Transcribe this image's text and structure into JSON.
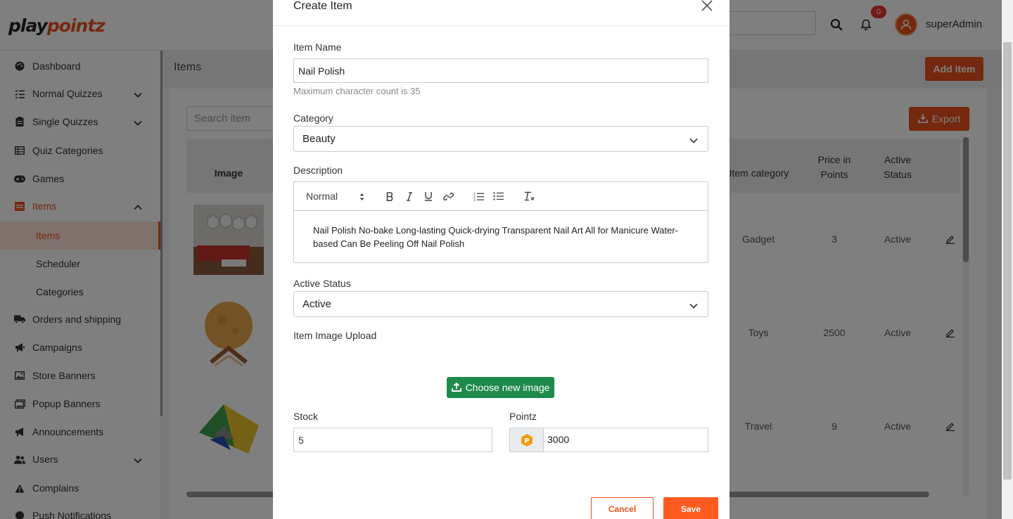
{
  "brand": {
    "part1": "play",
    "part2": "pointz"
  },
  "header": {
    "notification_count": "0",
    "username": "superAdmin"
  },
  "sidebar": {
    "items": [
      {
        "label": "Dashboard",
        "icon": "palette-icon"
      },
      {
        "label": "Normal Quizzes",
        "icon": "list-check-icon"
      },
      {
        "label": "Single Quizzes",
        "icon": "clipboard-icon"
      },
      {
        "label": "Quiz Categories",
        "icon": "table-list-icon"
      },
      {
        "label": "Games",
        "icon": "gamepad-icon"
      },
      {
        "label": "Items",
        "icon": "item-box-icon"
      },
      {
        "label": "Orders and shipping",
        "icon": "truck-icon"
      },
      {
        "label": "Campaigns",
        "icon": "megaphone-icon"
      },
      {
        "label": "Store Banners",
        "icon": "image-icon"
      },
      {
        "label": "Popup Banners",
        "icon": "images-icon"
      },
      {
        "label": "Announcements",
        "icon": "bullhorn-icon"
      },
      {
        "label": "Users",
        "icon": "users-icon"
      },
      {
        "label": "Complains",
        "icon": "warning-icon"
      },
      {
        "label": "Push Notifications",
        "icon": "circle-icon"
      }
    ],
    "sub_items": [
      "Items",
      "Scheduler",
      "Categories"
    ]
  },
  "main": {
    "title": "Items",
    "add_button": "Add item",
    "search_placeholder": "Search item",
    "export_button": "Export",
    "columns": [
      "Image",
      "Item category",
      "Price in Points",
      "Active Status"
    ],
    "rows": [
      {
        "category": "Gadget",
        "price": "3",
        "status": "Active"
      },
      {
        "category": "Toys",
        "price": "2500",
        "status": "Active"
      },
      {
        "category": "Travel",
        "price": "9",
        "status": "Active"
      }
    ]
  },
  "modal": {
    "title": "Create Item",
    "item_name_label": "Item Name",
    "item_name_value": "Nail Polish",
    "item_name_hint": "Maximum character count is 35",
    "category_label": "Category",
    "category_value": "Beauty",
    "description_label": "Description",
    "editor_format": "Normal",
    "description_text": "Nail Polish No-bake Long-lasting Quick-drying Transparent Nail Art All for Manicure Water-based Can Be Peeling Off Nail Polish",
    "active_status_label": "Active Status",
    "active_status_value": "Active",
    "image_upload_label": "Item Image Upload",
    "choose_image_button": "Choose new image",
    "stock_label": "Stock",
    "stock_value": "5",
    "pointz_label": "Pointz",
    "pointz_value": "3000",
    "cancel_button": "Cancel",
    "save_button": "Save"
  },
  "colors": {
    "accent": "#e8501c",
    "green": "#1e8a4c",
    "save": "#ff5a1f"
  }
}
